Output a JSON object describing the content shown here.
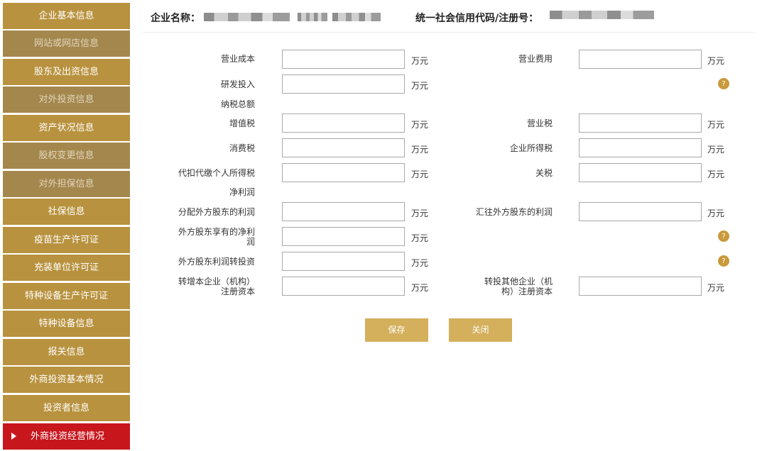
{
  "sidebar": {
    "items": [
      {
        "label": "企业基本信息"
      },
      {
        "label": "网站或网店信息"
      },
      {
        "label": "股东及出资信息"
      },
      {
        "label": "对外投资信息"
      },
      {
        "label": "资产状况信息"
      },
      {
        "label": "股权变更信息"
      },
      {
        "label": "对外担保信息"
      },
      {
        "label": "社保信息"
      },
      {
        "label": "疫苗生产许可证"
      },
      {
        "label": "充装单位许可证"
      },
      {
        "label": "特种设备生产许可证"
      },
      {
        "label": "特种设备信息"
      },
      {
        "label": "报关信息"
      },
      {
        "label": "外商投资基本情况"
      },
      {
        "label": "投资者信息"
      },
      {
        "label": "外商投资经营情况"
      }
    ]
  },
  "header": {
    "company_label": "企业名称：",
    "credit_label": "统一社会信用代码/注册号："
  },
  "form": {
    "unit": "万元",
    "help": "?",
    "operating_cost": "营业成本",
    "operating_expense": "营业费用",
    "rd_investment": "研发投入",
    "total_tax": "纳税总额",
    "vat": "增值税",
    "business_tax": "营业税",
    "consumption_tax": "消费税",
    "corp_income_tax": "企业所得税",
    "withheld_personal_tax": "代扣代缴个人所得税",
    "customs_duty": "关税",
    "net_profit": "净利润",
    "profit_to_foreign": "分配外方股东的利润",
    "profit_remitted": "汇往外方股东的利润",
    "foreign_net_profit_1": "外方股东享有的净利",
    "foreign_net_profit_2": "润",
    "profit_reinvest": "外方股东利润转投资",
    "capital_increase_1": "转增本企业（机构）",
    "capital_increase_2": "注册资本",
    "invest_other_1": "转投其他企业（机",
    "invest_other_2": "构）注册资本"
  },
  "buttons": {
    "save": "保存",
    "close": "关闭"
  }
}
